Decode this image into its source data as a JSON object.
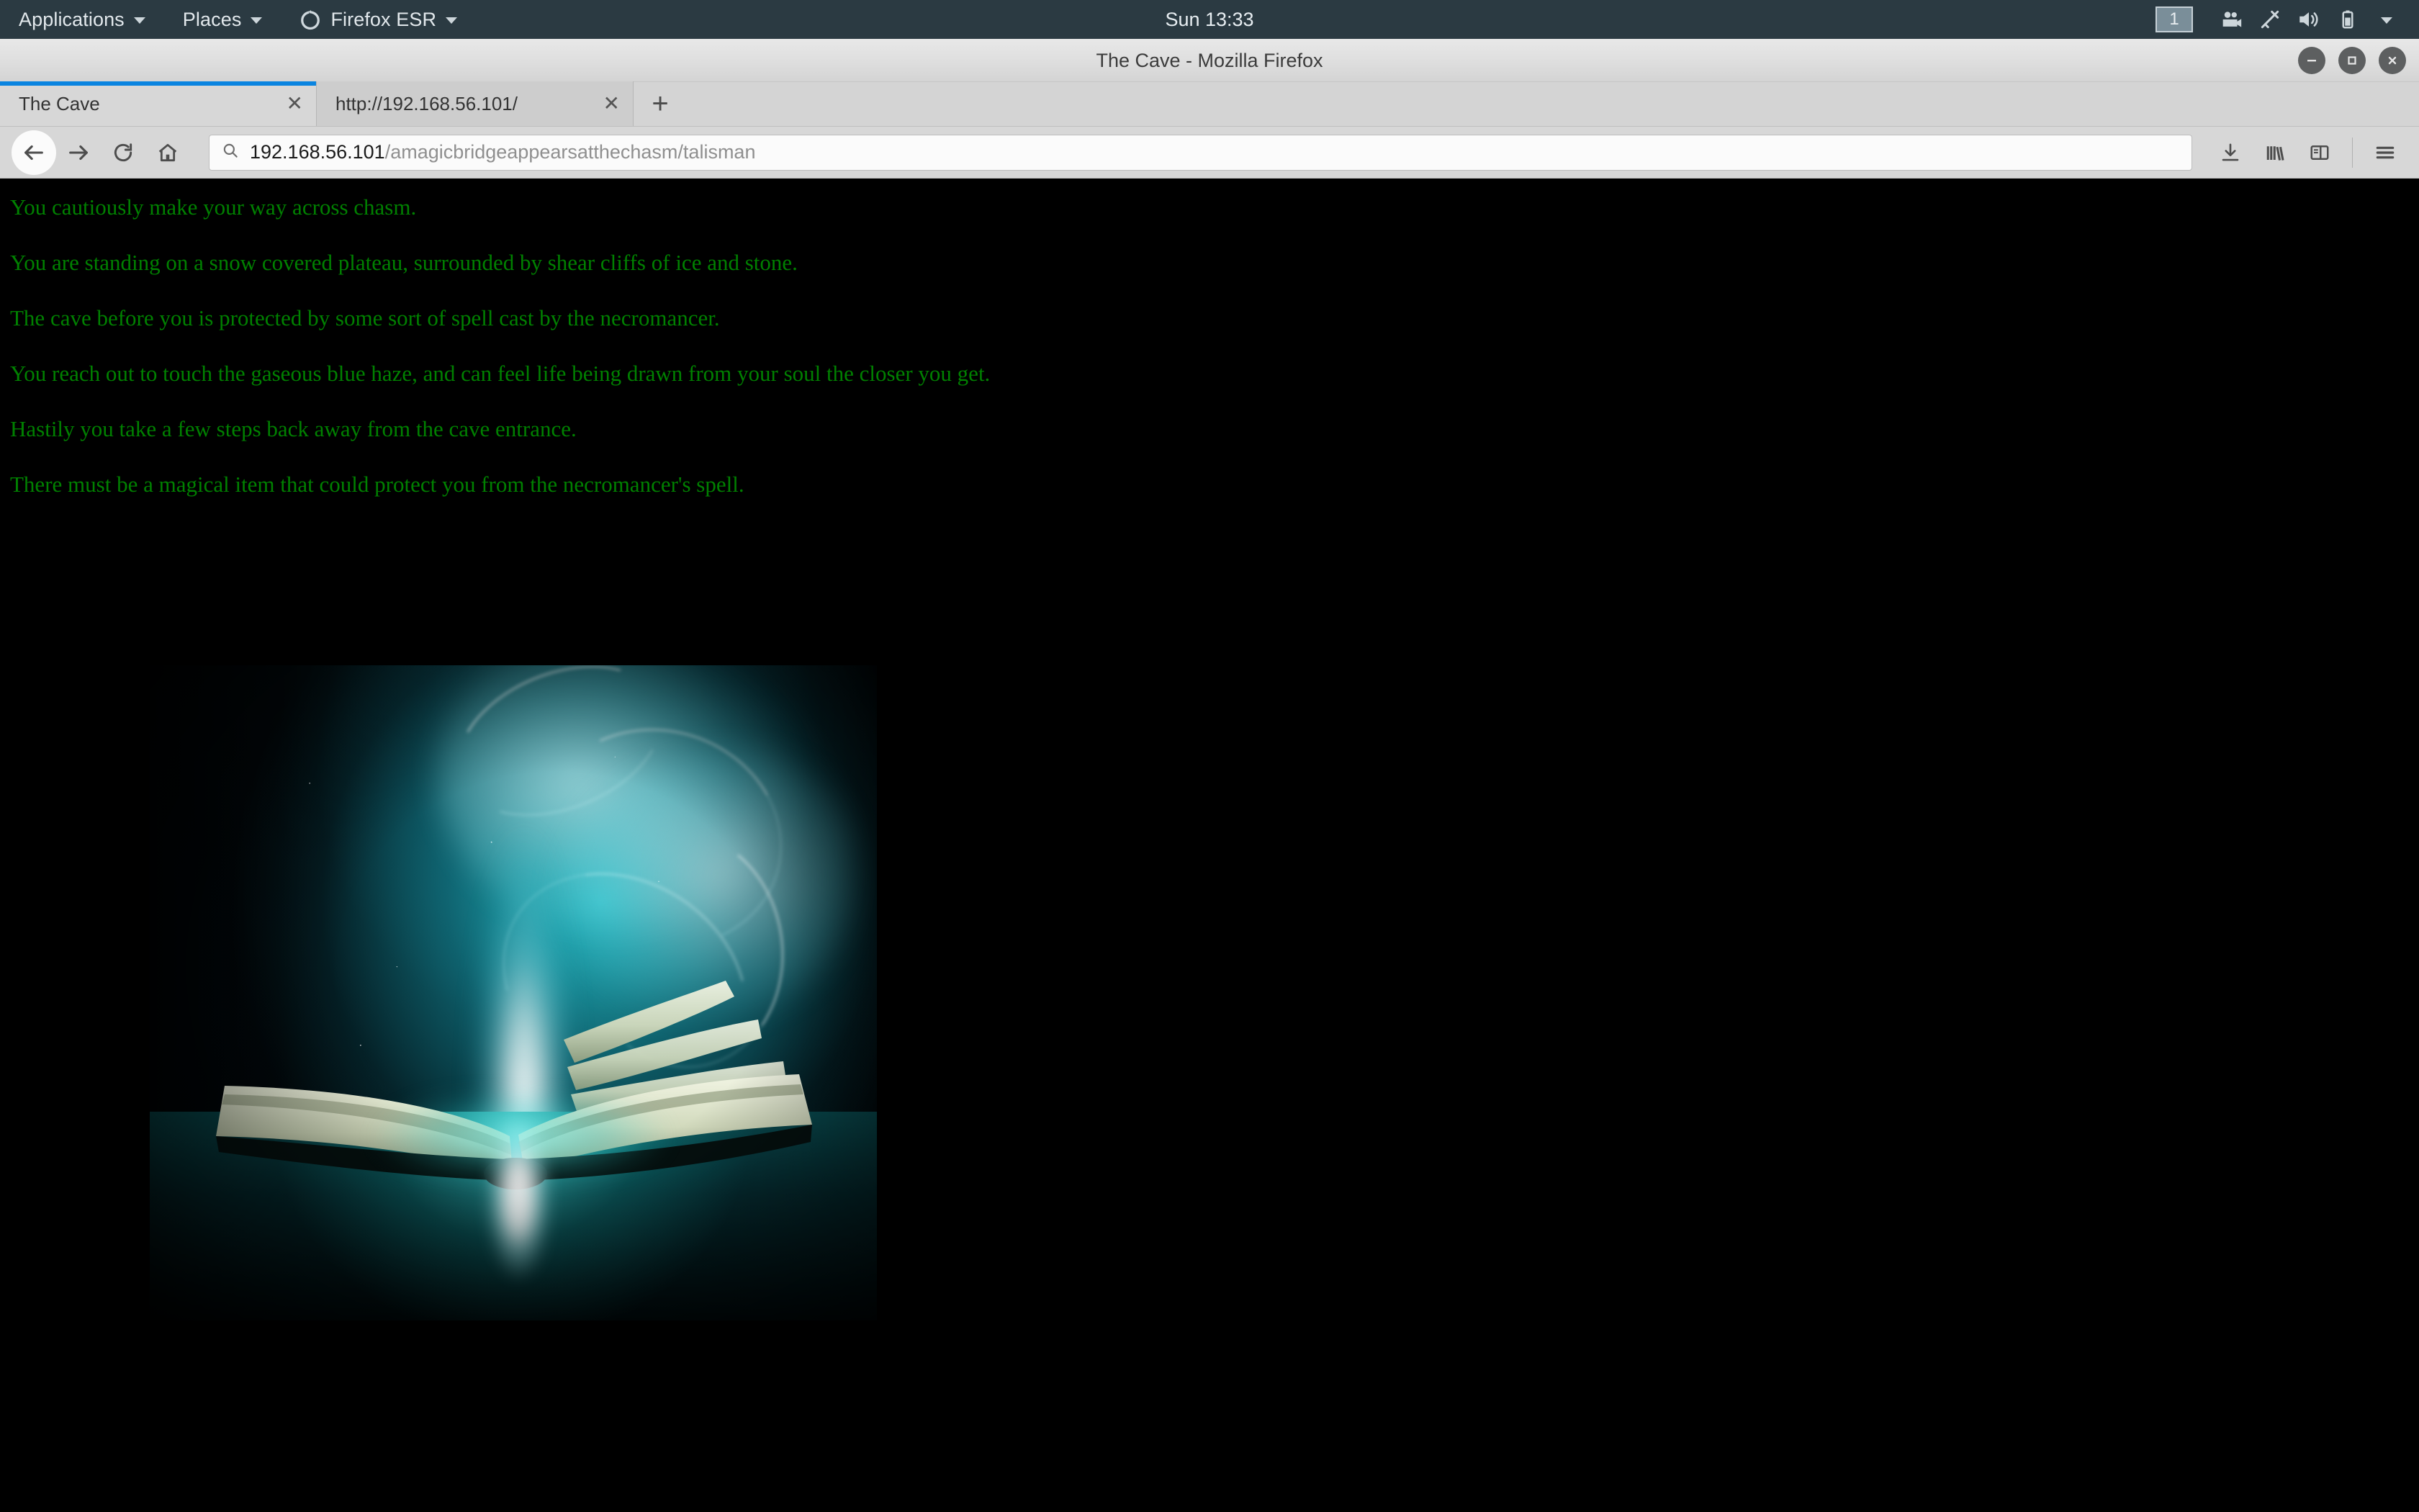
{
  "desktop": {
    "panel": {
      "applications_label": "Applications",
      "places_label": "Places",
      "firefox_label": "Firefox ESR",
      "clock": "Sun 13:33",
      "workspace": "1",
      "tray_icons": [
        "workspace-indicator",
        "screen-recorder-icon",
        "color-picker-icon",
        "volume-icon",
        "battery-icon",
        "system-menu-chevron-icon"
      ]
    }
  },
  "browser": {
    "window_title": "The Cave - Mozilla Firefox",
    "window_controls": {
      "minimize": "−",
      "maximize": "□",
      "close": "✕"
    },
    "tabs": [
      {
        "title": "The Cave",
        "close_label": "✕",
        "active": true
      },
      {
        "title": "http://192.168.56.101/",
        "close_label": "✕",
        "active": false
      }
    ],
    "new_tab_label": "+",
    "toolbar": {
      "back": "back-button",
      "forward": "forward-button",
      "reload": "reload-button",
      "home": "home-button",
      "downloads": "downloads-button",
      "library": "library-button",
      "sidebar": "sidebar-button",
      "menu": "menu-button"
    },
    "urlbar": {
      "host": "192.168.56.101",
      "path": "/amagicbridgeappearsatthechasm/talisman",
      "search_icon": "search-icon"
    }
  },
  "page": {
    "background_color": "#000000",
    "text_color": "#008000",
    "lines": [
      "You cautiously make your way across chasm.",
      "You are standing on a snow covered plateau, surrounded by shear cliffs of ice and stone.",
      "The cave before you is protected by some sort of spell cast by the necromancer.",
      "You reach out to touch the gaseous blue haze, and can feel life being drawn from your soul the closer you get.",
      "Hastily you take a few steps back away from the cave entrance.",
      "There must be a magical item that could protect you from the necromancer's spell."
    ],
    "image": {
      "name": "magic-book-image",
      "description": "Open book emitting a column of bright white-teal magical light and swirling smoke",
      "accent_color": "#1fc8d4"
    }
  }
}
